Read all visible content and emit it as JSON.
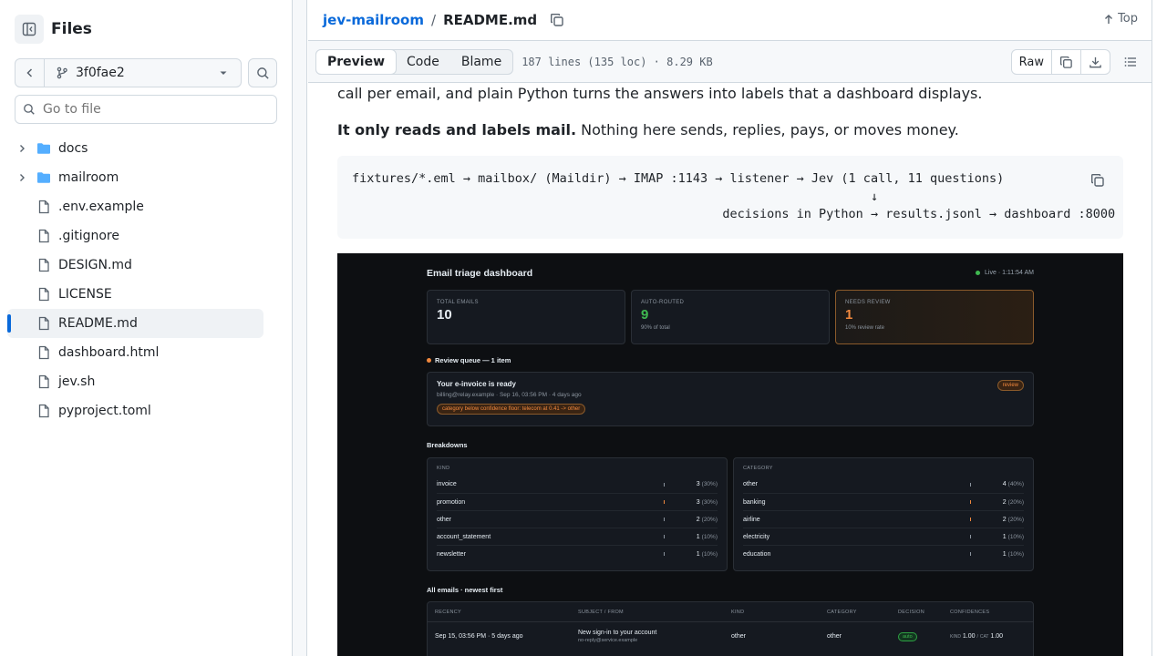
{
  "sidebar": {
    "title": "Files",
    "branch": "3f0fae2",
    "goto_placeholder": "Go to file",
    "items": [
      {
        "type": "folder",
        "name": "docs"
      },
      {
        "type": "folder",
        "name": "mailroom"
      },
      {
        "type": "file",
        "name": ".env.example"
      },
      {
        "type": "file",
        "name": ".gitignore"
      },
      {
        "type": "file",
        "name": "DESIGN.md"
      },
      {
        "type": "file",
        "name": "LICENSE"
      },
      {
        "type": "file",
        "name": "README.md",
        "active": true
      },
      {
        "type": "file",
        "name": "dashboard.html"
      },
      {
        "type": "file",
        "name": "jev.sh"
      },
      {
        "type": "file",
        "name": "pyproject.toml"
      }
    ]
  },
  "header": {
    "repo": "jev-mailroom",
    "separator": "/",
    "file": "README.md",
    "top_label": "Top"
  },
  "toolbar": {
    "tabs": [
      "Preview",
      "Code",
      "Blame"
    ],
    "active_tab": "Preview",
    "meta": "187 lines (135 loc) · 8.29 KB",
    "raw_label": "Raw"
  },
  "content": {
    "para1": "call per email, and plain Python turns the answers into labels that a dashboard displays.",
    "para2_bold": "It only reads and labels mail.",
    "para2_rest": " Nothing here sends, replies, pays, or moves money.",
    "code_line1": "fixtures/*.eml → mailbox/ (Maildir) → IMAP :1143 → listener → Jev (1 call, 11 questions)",
    "code_line2": "                                                                      ↓",
    "code_line3": "                                                  decisions in Python → results.jsonl → dashboard :8000"
  },
  "dashboard": {
    "title": "Email triage dashboard",
    "live": "Live · 1:11:54 AM",
    "kpis": [
      {
        "label": "TOTAL EMAILS",
        "value": "10",
        "sub": "",
        "color": "#e6edf3"
      },
      {
        "label": "AUTO-ROUTED",
        "value": "9",
        "sub": "90% of total",
        "color": "#3fb950"
      },
      {
        "label": "NEEDS REVIEW",
        "value": "1",
        "sub": "10% review rate",
        "color": "#f0883e"
      }
    ],
    "review_title": "Review queue — 1 item",
    "review": {
      "subject": "Your e-invoice is ready",
      "from": "billing@relay.example · Sep 16, 03:56 PM · 4 days ago",
      "reason": "category below confidence floor: telecom at 0.41 -> other",
      "badge": "review"
    },
    "breakdowns_title": "Breakdowns",
    "kind": {
      "header": "KIND",
      "rows": [
        {
          "k": "invoice",
          "n": "3",
          "p": "(30%)"
        },
        {
          "k": "promotion",
          "n": "3",
          "p": "(30%)"
        },
        {
          "k": "other",
          "n": "2",
          "p": "(20%)"
        },
        {
          "k": "account_statement",
          "n": "1",
          "p": "(10%)"
        },
        {
          "k": "newsletter",
          "n": "1",
          "p": "(10%)"
        }
      ]
    },
    "category": {
      "header": "CATEGORY",
      "rows": [
        {
          "k": "other",
          "n": "4",
          "p": "(40%)"
        },
        {
          "k": "banking",
          "n": "2",
          "p": "(20%)"
        },
        {
          "k": "airline",
          "n": "2",
          "p": "(20%)"
        },
        {
          "k": "electricity",
          "n": "1",
          "p": "(10%)"
        },
        {
          "k": "education",
          "n": "1",
          "p": "(10%)"
        }
      ]
    },
    "all_title": "All emails · newest first",
    "table": {
      "headers": [
        "RECENCY",
        "SUBJECT / FROM",
        "KIND",
        "CATEGORY",
        "DECISION",
        "CONFIDENCES"
      ],
      "row": {
        "recency": "Sep 15, 03:56 PM · 5 days ago",
        "subject": "New sign-in to your account",
        "from": "no-reply@service.example",
        "kind": "other",
        "category": "other",
        "decision": "auto",
        "conf_kind_label": "KIND",
        "conf_kind": "1.00",
        "conf_sep": "/",
        "conf_cat_label": "CAT",
        "conf_cat": "1.00"
      }
    }
  }
}
